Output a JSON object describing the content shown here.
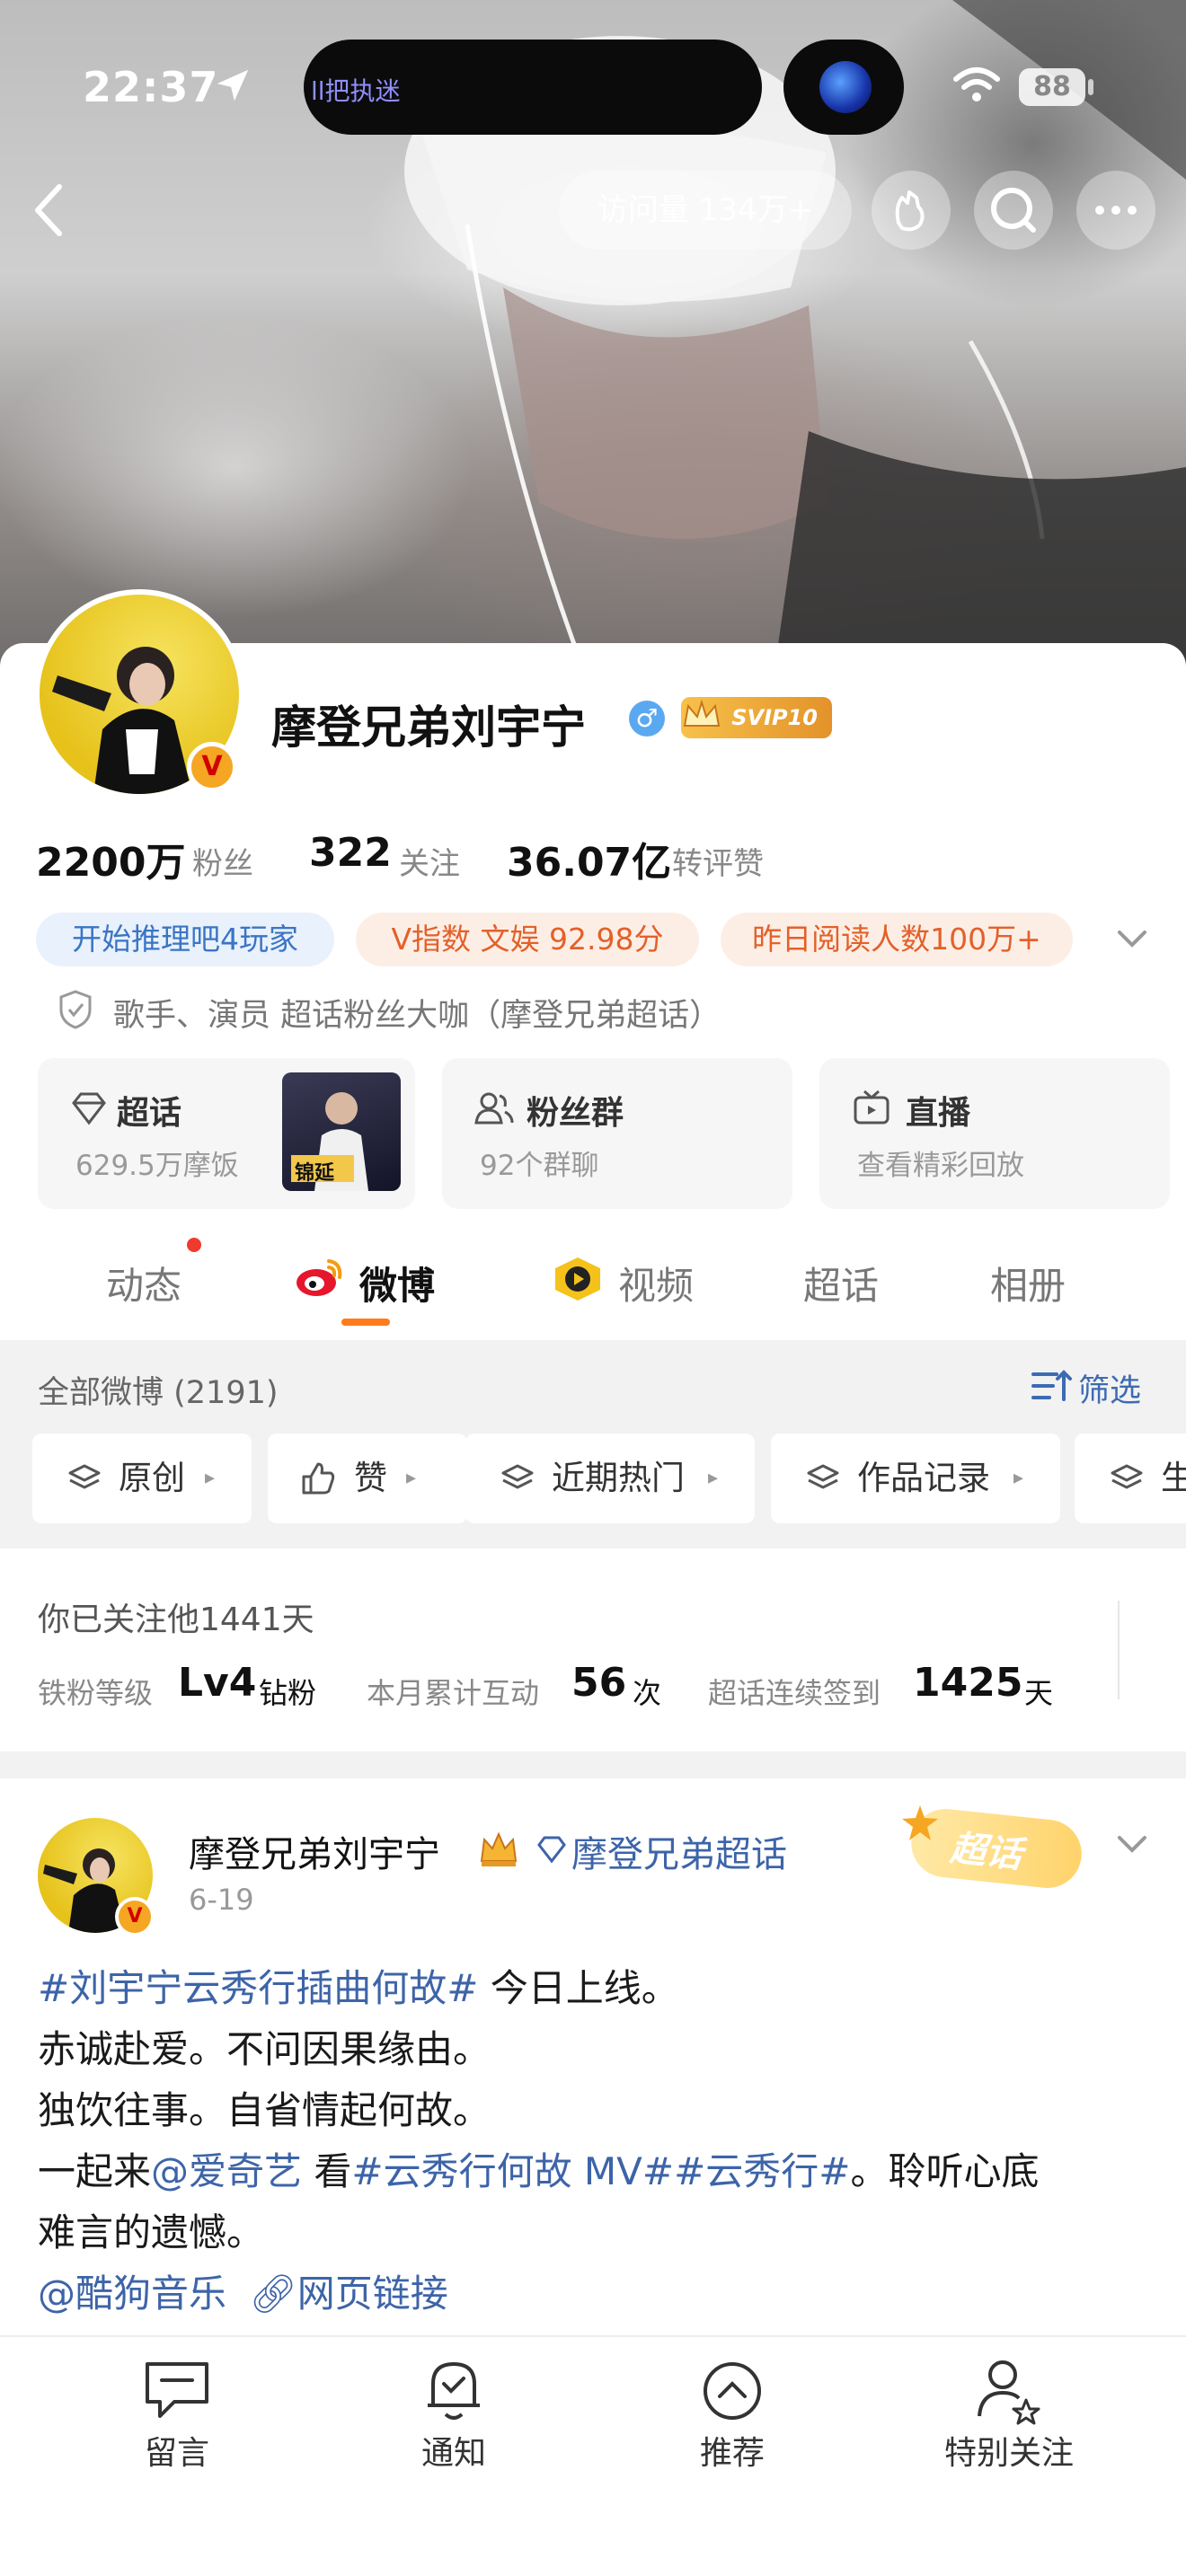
{
  "status_bar": {
    "time": "22:37",
    "island_text": "ll把执迷",
    "battery": "88"
  },
  "nav": {
    "visits": "访问量 134万+"
  },
  "profile": {
    "name": "摩登兄弟刘宇宁",
    "gender_symbol": "♂",
    "svip": "SVIP10",
    "verified_badge": "V",
    "stats": [
      {
        "num": "2200万",
        "label": "粉丝"
      },
      {
        "num": "322",
        "label": "关注"
      },
      {
        "num": "36.07亿",
        "label": "转评赞"
      }
    ],
    "tags": [
      "开始推理吧4玩家",
      "V指数 文娱 92.98分",
      "昨日阅读人数100万+"
    ],
    "description": "歌手、演员 超话粉丝大咖（摩登兄弟超话）",
    "boxes": [
      {
        "title": "超话",
        "sub": "629.5万摩饭",
        "thumb_text": "锦延"
      },
      {
        "title": "粉丝群",
        "sub": "92个群聊"
      },
      {
        "title": "直播",
        "sub": "查看精彩回放"
      }
    ]
  },
  "tabs": [
    "动态",
    "微博",
    "视频",
    "超话",
    "相册"
  ],
  "filters": {
    "count_label": "全部微博 (2191)",
    "filter_label": "筛选",
    "chips": [
      "原创",
      "赞",
      "近期热门",
      "作品记录",
      "生"
    ]
  },
  "follow_info": {
    "days": "你已关注他1441天",
    "level_label": "铁粉等级",
    "level_value": "Lv4",
    "level_suffix": "钻粉",
    "interact_label": "本月累计互动",
    "interact_value": "56",
    "interact_suffix": "次",
    "signin_label": "超话连续签到",
    "signin_value": "1425",
    "signin_suffix": "天"
  },
  "post": {
    "author": "摩登兄弟刘宇宁",
    "topic": "摩登兄弟超话",
    "badge": "超话",
    "date": "6-19",
    "line1_tag": "#刘宇宁云秀行插曲何故#",
    "line1_rest": " 今日上线。",
    "line2": "赤诚赴爱。不问因果缘由。",
    "line3": "独饮往事。自省情起何故。",
    "line4_a": "一起来",
    "line4_mention": "@爱奇艺",
    "line4_b": " 看",
    "line4_tags": "#云秀行何故 MV##云秀行#",
    "line4_c": "。聆听心底",
    "line5": "难言的遗憾。",
    "line6_mention": "@酷狗音乐",
    "line6_link": "网页链接"
  },
  "bottom_bar": [
    "留言",
    "通知",
    "推荐",
    "特别关注"
  ]
}
